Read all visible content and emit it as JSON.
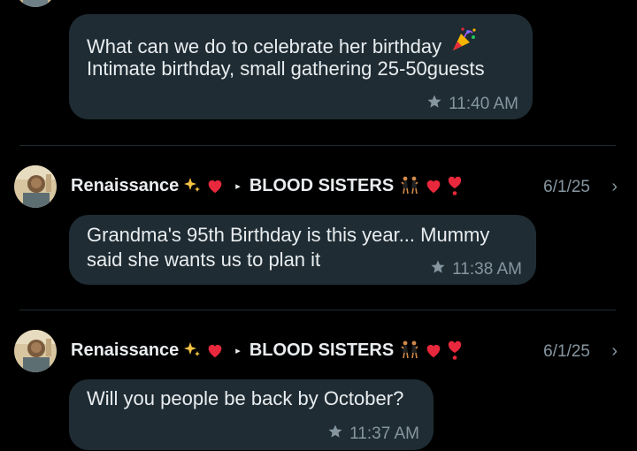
{
  "messages": [
    {
      "line1": "What can we do to celebrate her birthday",
      "line2": "Intimate birthday, small gathering 25-50guests",
      "time": "11:40 AM"
    },
    {
      "sender": "Renaissance",
      "group": "BLOOD SISTERS",
      "date": "6/1/25",
      "line1": "Grandma's 95th Birthday is this year... Mummy",
      "line2": "said she wants us to plan it",
      "time": "11:38 AM"
    },
    {
      "sender": "Renaissance",
      "group": "BLOOD SISTERS",
      "date": "6/1/25",
      "line1": "Will you people be back by October?",
      "time": "11:37 AM"
    }
  ],
  "icons": {
    "star": "star-icon",
    "sparkles": "sparkles-icon",
    "heart": "red-heart-icon",
    "dancers": "dancers-icon",
    "exclamation_heart": "heart-exclamation-icon",
    "party_popper": "party-popper-icon",
    "chevron": "chevron-right-icon"
  },
  "colors": {
    "background": "#000000",
    "bubble": "#1f2c34",
    "text": "#e9edef",
    "meta": "#8696a0",
    "heart": "#e8283c"
  }
}
